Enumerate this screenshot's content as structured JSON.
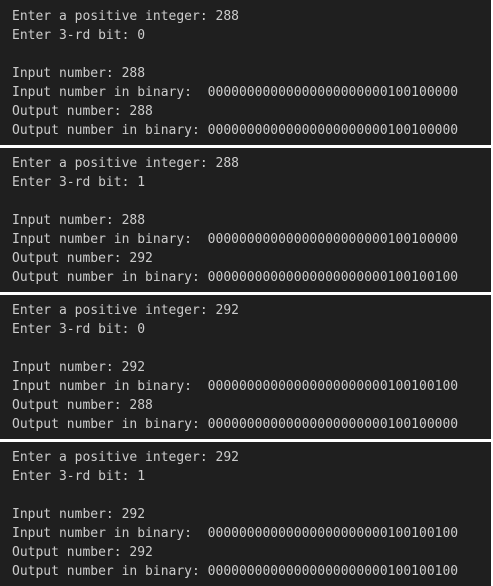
{
  "terminal_runs": [
    {
      "prompt_integer": "Enter a positive integer: 288",
      "prompt_bit": "Enter 3-rd bit: 0",
      "input_number": "Input number: 288",
      "input_binary": "Input number in binary:  00000000000000000000000100100000",
      "output_number": "Output number: 288",
      "output_binary": "Output number in binary: 00000000000000000000000100100000"
    },
    {
      "prompt_integer": "Enter a positive integer: 288",
      "prompt_bit": "Enter 3-rd bit: 1",
      "input_number": "Input number: 288",
      "input_binary": "Input number in binary:  00000000000000000000000100100000",
      "output_number": "Output number: 292",
      "output_binary": "Output number in binary: 00000000000000000000000100100100"
    },
    {
      "prompt_integer": "Enter a positive integer: 292",
      "prompt_bit": "Enter 3-rd bit: 0",
      "input_number": "Input number: 292",
      "input_binary": "Input number in binary:  00000000000000000000000100100100",
      "output_number": "Output number: 288",
      "output_binary": "Output number in binary: 00000000000000000000000100100000"
    },
    {
      "prompt_integer": "Enter a positive integer: 292",
      "prompt_bit": "Enter 3-rd bit: 1",
      "input_number": "Input number: 292",
      "input_binary": "Input number in binary:  00000000000000000000000100100100",
      "output_number": "Output number: 292",
      "output_binary": "Output number in binary: 00000000000000000000000100100100"
    }
  ]
}
